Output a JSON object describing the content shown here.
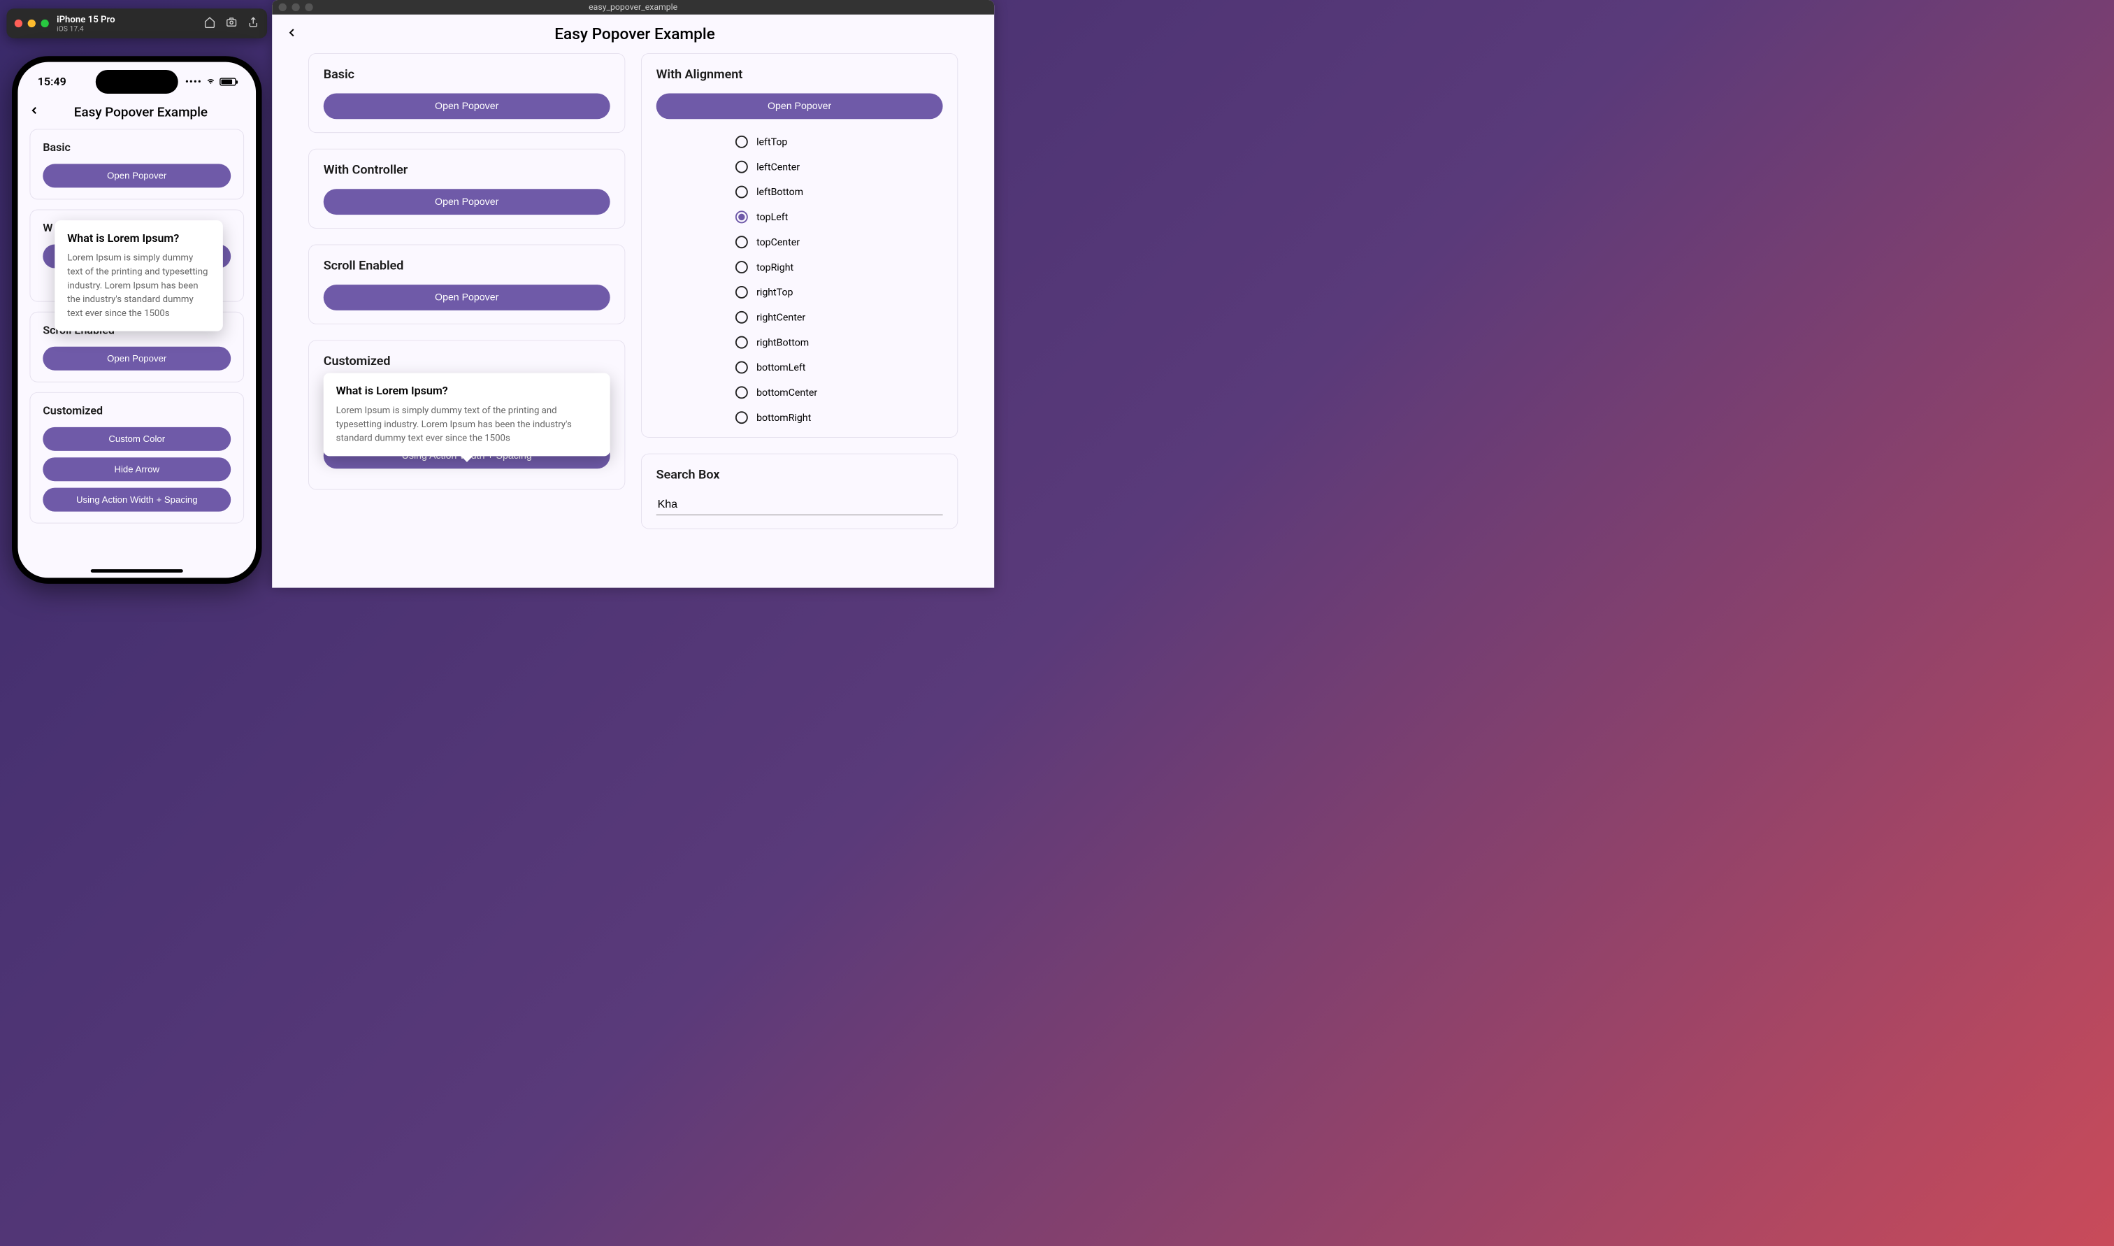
{
  "simulator": {
    "device_name": "iPhone 15 Pro",
    "device_os": "iOS 17.4"
  },
  "phone": {
    "status_time": "15:49",
    "app_title": "Easy Popover Example",
    "cards": {
      "basic": {
        "title": "Basic",
        "button": "Open Popover"
      },
      "with_controller_label": "W",
      "scroll": {
        "title": "Scroll Enabled",
        "button": "Open Popover"
      },
      "customized": {
        "title": "Customized",
        "buttons": [
          "Custom Color",
          "Hide Arrow",
          "Using Action Width + Spacing"
        ]
      }
    },
    "popover": {
      "title": "What is Lorem Ipsum?",
      "body": "Lorem Ipsum is simply dummy text of the printing and typesetting industry. Lorem Ipsum has been the industry's standard dummy text ever since the 1500s"
    }
  },
  "desktop": {
    "window_title": "easy_popover_example",
    "app_title": "Easy Popover Example",
    "left_column": {
      "basic": {
        "title": "Basic",
        "button": "Open Popover"
      },
      "controller": {
        "title": "With Controller",
        "button": "Open Popover"
      },
      "scroll": {
        "title": "Scroll Enabled",
        "button": "Open Popover"
      },
      "customized": {
        "title": "Customized",
        "button": "Using Action Width + Spacing"
      }
    },
    "right_column": {
      "alignment": {
        "title": "With Alignment",
        "button": "Open Popover",
        "options": [
          "leftTop",
          "leftCenter",
          "leftBottom",
          "topLeft",
          "topCenter",
          "topRight",
          "rightTop",
          "rightCenter",
          "rightBottom",
          "bottomLeft",
          "bottomCenter",
          "bottomRight"
        ],
        "selected": "topLeft"
      },
      "search": {
        "title": "Search Box",
        "value": "Kha"
      }
    },
    "popover": {
      "title": "What is Lorem Ipsum?",
      "body": "Lorem Ipsum is simply dummy text of the printing and typesetting industry. Lorem Ipsum has been the industry's standard dummy text ever since the 1500s"
    }
  },
  "colors": {
    "accent": "#6f5aa8"
  }
}
